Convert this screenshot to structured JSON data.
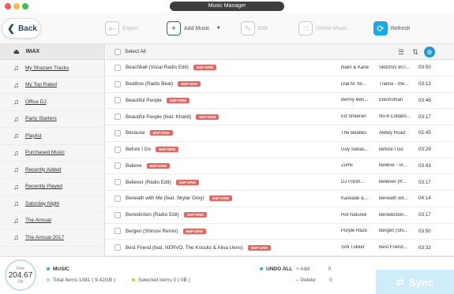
{
  "window": {
    "title": "Music Manager",
    "traffic_colors": [
      "#fc5753",
      "#fdbc40",
      "#33c748"
    ]
  },
  "toolbar": {
    "back_label": "Back",
    "export_label": "Export",
    "add_music_label": "Add Music",
    "edit_label": "Edit",
    "delete_music_label": "Delete Music",
    "refresh_label": "Refresh"
  },
  "sidebar": {
    "header": "IMAX",
    "items": [
      {
        "label": "My Shazam Tracks"
      },
      {
        "label": "My Top Rated"
      },
      {
        "label": "Office DJ"
      },
      {
        "label": "Party Starters"
      },
      {
        "label": "Playlist"
      },
      {
        "label": "Purchased Music"
      },
      {
        "label": "Recently Added"
      },
      {
        "label": "Recently Played"
      },
      {
        "label": "Saturday Night"
      },
      {
        "label": "The Annual"
      },
      {
        "label": "The Annual 2017"
      }
    ]
  },
  "list": {
    "select_all_label": "Select All",
    "badge_label": "M4P-DRM",
    "tracks": [
      {
        "name": "Beachball (Vocal Radio Edit)",
        "artist": "Nalin & Kane",
        "album": "Skitzmix 907...",
        "time": "03:50"
      },
      {
        "name": "Beatbox (Radio Beat)",
        "artist": "Dial M. for...",
        "album": "Trance - the...",
        "time": "03:13"
      },
      {
        "name": "Beautiful People",
        "artist": "Benny Ben...",
        "album": "Electroman",
        "time": "03:46"
      },
      {
        "name": "Beautiful People (feat. Khalid)",
        "artist": "Ed Sheeran",
        "album": "No.6 Collabo...",
        "time": "03:17"
      },
      {
        "name": "Because",
        "artist": "The Beatles",
        "album": "Abbey Road",
        "time": "02:45"
      },
      {
        "name": "Before I Go",
        "artist": "Guy Sebas...",
        "album": "Before I Go",
        "time": "03:29"
      },
      {
        "name": "Believe",
        "artist": "Zumii",
        "album": "Believe - Si...",
        "time": "03:43"
      },
      {
        "name": "Believer (Radio Edit)",
        "artist": "DJ Fresh...",
        "album": "Believer (R...",
        "time": "03:17"
      },
      {
        "name": "Beneath with Me (feat. Skylar Grey)",
        "artist": "Kaskade &...",
        "album": "Beneath wit...",
        "time": "04:14"
      },
      {
        "name": "Benediction (Radio Edit)",
        "artist": "Hot Natured",
        "album": "Benediction...",
        "time": "03:17"
      },
      {
        "name": "Bergen (Shinovi Remix)",
        "artist": "Purple Haze",
        "album": "Bergen (Shi...",
        "time": "03:50"
      },
      {
        "name": "Best Friend (feat. NERVO, The Knocks & Alisa Ueno)",
        "artist": "Sofi Tukker",
        "album": "Best Friend...",
        "time": "03:32"
      }
    ]
  },
  "footer": {
    "storage_free_label": "Free",
    "storage_value": "204.67",
    "storage_unit": "GB",
    "music_label": "MUSIC",
    "total_items": "Total items 1081 ( 9.42GB )",
    "selected_items": "Selected items 0 ( 0B )",
    "undo_all_label": "UNDO ALL",
    "add_label": "Add:",
    "add_count": "0",
    "delete_label": "Delete:",
    "delete_count": "0",
    "sync_label": "Sync",
    "music_dot_color": "#2bb7c6",
    "selected_dot_color": "#f2b632",
    "total_dot_color": "#a7d8ee"
  },
  "icons": {
    "back": "chevron-left-icon",
    "export": "export-icon",
    "add_music": "add-music-icon",
    "edit": "edit-icon",
    "delete": "delete-icon",
    "refresh": "refresh-icon",
    "playlist": "playlist-icon",
    "sync": "sync-icon"
  }
}
